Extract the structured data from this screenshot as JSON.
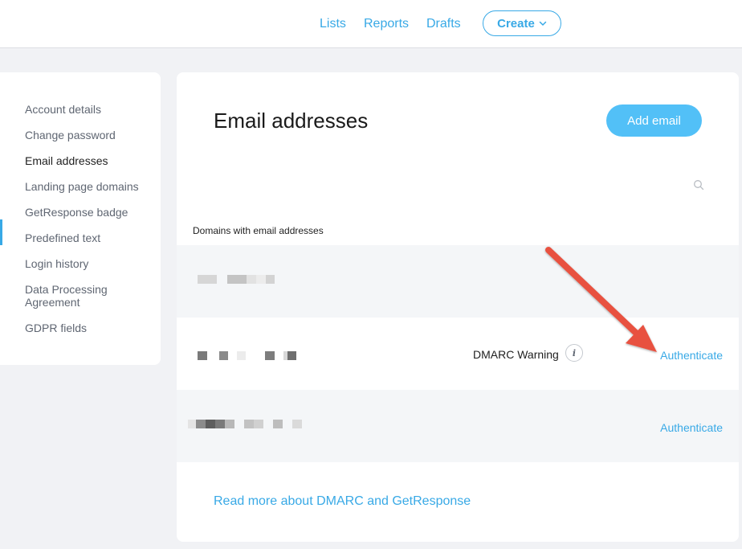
{
  "topnav": {
    "lists": "Lists",
    "reports": "Reports",
    "drafts": "Drafts",
    "create": "Create"
  },
  "sidebar": {
    "items": [
      {
        "label": "Account details",
        "active": false
      },
      {
        "label": "Change password",
        "active": false
      },
      {
        "label": "Email addresses",
        "active": true
      },
      {
        "label": "Landing page domains",
        "active": false
      },
      {
        "label": "GetResponse badge",
        "active": false
      },
      {
        "label": "Predefined text",
        "active": false
      },
      {
        "label": "Login history",
        "active": false
      },
      {
        "label": "Data Processing Agreement",
        "active": false
      },
      {
        "label": "GDPR fields",
        "active": false
      }
    ]
  },
  "main": {
    "title": "Email addresses",
    "add_button": "Add email",
    "section_label": "Domains with email addresses",
    "rows": [
      {
        "status": "",
        "action": ""
      },
      {
        "status": "DMARC Warning",
        "action": "Authenticate"
      },
      {
        "status": "",
        "action": "Authenticate"
      }
    ],
    "read_more": "Read more about DMARC and GetResponse"
  },
  "colors": {
    "accent": "#38a9e6",
    "button_bg": "#52c0f7",
    "arrow": "#e8513f",
    "page_bg": "#f1f2f5"
  },
  "icons": [
    "chevron-down-icon",
    "search-icon",
    "info-icon",
    "red-arrow-annotation"
  ]
}
